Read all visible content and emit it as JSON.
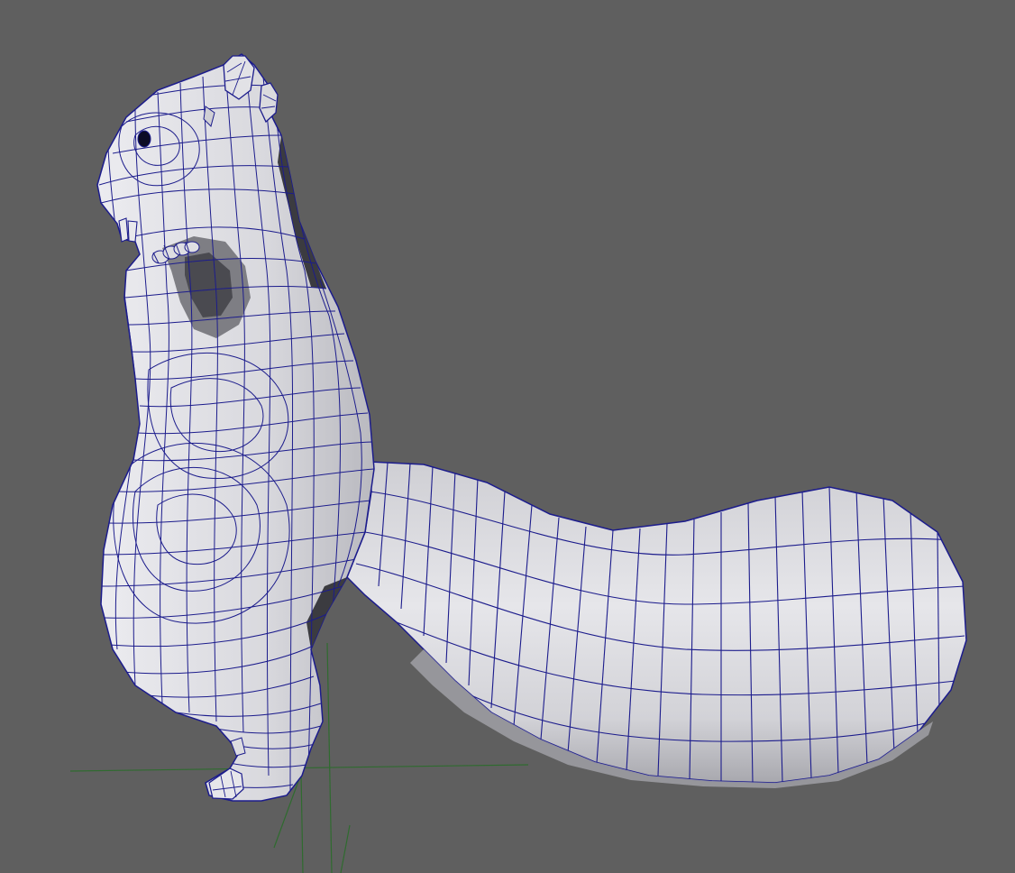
{
  "viewport": {
    "background_color": "#5f5f5f",
    "wireframe_color": "#1c1c8c",
    "surface_color": "#d6d6dc",
    "surface_light_color": "#ececf0",
    "surface_shade_color": "#a6a6ac",
    "shadow_color": "#3a3a3e",
    "grid_color": "#2f6b2f",
    "model": {
      "subject": "squirrel",
      "display_mode": "wireframe-on-shaded",
      "selected": false
    },
    "icons": {
      "grid": "ground-grid-icon",
      "model": "squirrel-mesh-icon"
    }
  }
}
